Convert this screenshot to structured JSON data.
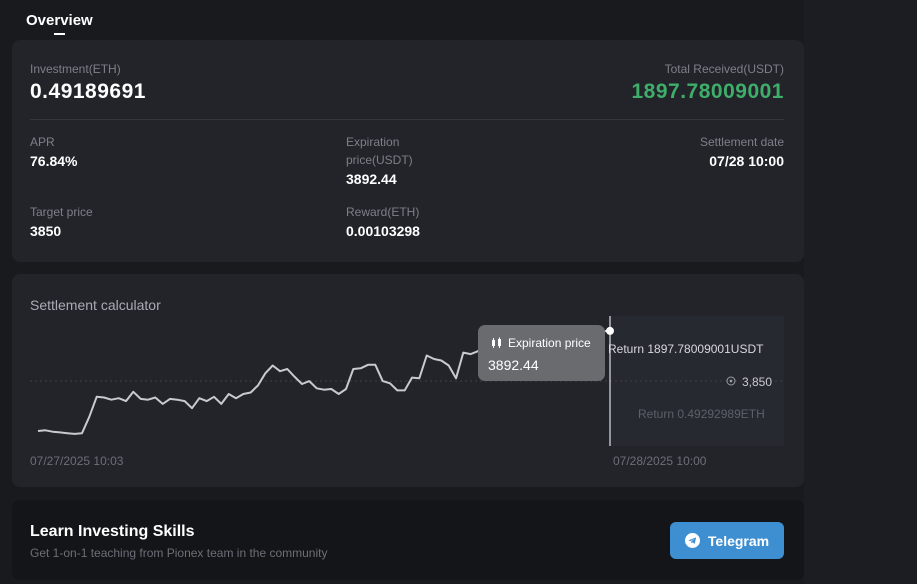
{
  "tabs": {
    "overview": "Overview"
  },
  "summary": {
    "investment_label": "Investment(ETH)",
    "investment_value": "0.49189691",
    "total_received_label": "Total Received(USDT)",
    "total_received_value": "1897.78009001",
    "apr_label": "APR",
    "apr_value": "76.84%",
    "expiration_label_1": "Expiration",
    "expiration_label_2": "price(USDT)",
    "expiration_value": "3892.44",
    "settlement_label": "Settlement date",
    "settlement_value": "07/28 10:00",
    "target_label": "Target price",
    "target_value": "3850",
    "reward_label": "Reward(ETH)",
    "reward_value": "0.00103298"
  },
  "calculator": {
    "title": "Settlement calculator",
    "tooltip_label": "Expiration price",
    "tooltip_value": "3892.44",
    "return_usdt": "Return 1897.78009001USDT",
    "strike_label": "3,850",
    "return_eth": "Return 0.49292989ETH",
    "start_date": "07/27/2025 10:03",
    "end_date": "07/28/2025 10:00"
  },
  "chart_data": {
    "type": "line",
    "x_start": "07/27/2025 10:03",
    "x_end": "07/28/2025 10:00",
    "series": [
      {
        "values": [
          3752,
          3753,
          3751,
          3750,
          3749,
          3748,
          3749,
          3772,
          3800,
          3799,
          3796,
          3798,
          3794,
          3807,
          3797,
          3796,
          3799,
          3790,
          3797,
          3796,
          3794,
          3784,
          3798,
          3794,
          3800,
          3790,
          3804,
          3798,
          3804,
          3806,
          3816,
          3833,
          3844,
          3836,
          3839,
          3828,
          3818,
          3822,
          3812,
          3810,
          3811,
          3804,
          3811,
          3839,
          3840,
          3845,
          3845,
          3822,
          3819,
          3809,
          3809,
          3827,
          3826,
          3858,
          3853,
          3851,
          3844,
          3826,
          3862,
          3860,
          3864,
          3877,
          3868,
          3851,
          3851,
          3846,
          3857,
          3848,
          3840,
          3841,
          3864,
          3868,
          3891,
          3898,
          3891,
          3888,
          3894,
          3892,
          3892.44
        ]
      }
    ],
    "reference_line": 3850,
    "marker_value": 3892.44
  },
  "learn": {
    "title": "Learn Investing Skills",
    "subtitle": "Get 1-on-1 teaching from Pionex team in the community",
    "button_label": "Telegram"
  },
  "colors": {
    "accent_green": "#3fae6a",
    "telegram_blue": "#3d8fd1",
    "card_bg": "#22242a"
  }
}
